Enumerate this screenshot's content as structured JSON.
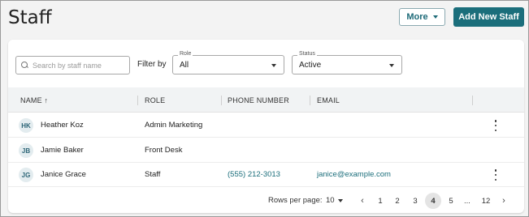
{
  "header": {
    "title": "Staff",
    "more_label": "More",
    "add_label": "Add New Staff"
  },
  "filters": {
    "search_placeholder": "Search by staff name",
    "filter_by_label": "Filter by",
    "role": {
      "legend": "Role",
      "value": "All"
    },
    "status": {
      "legend": "Status",
      "value": "Active"
    }
  },
  "table": {
    "columns": [
      "NAME ↑",
      "ROLE",
      "PHONE NUMBER",
      "EMAIL"
    ],
    "rows": [
      {
        "initials": "HK",
        "name": "Heather Koz",
        "role": "Admin Marketing",
        "phone": "",
        "email": ""
      },
      {
        "initials": "JB",
        "name": "Jamie Baker",
        "role": "Front Desk",
        "phone": "",
        "email": ""
      },
      {
        "initials": "JG",
        "name": "Janice Grace",
        "role": "Staff",
        "phone": "(555) 212-3013",
        "email": "janice@example.com"
      }
    ]
  },
  "pagination": {
    "rows_per_page_label": "Rows per page:",
    "rows_per_page_value": "10",
    "prev_icon": "chevron-left-icon",
    "next_icon": "chevron-right-icon",
    "pages": [
      "1",
      "2",
      "3",
      "4",
      "5",
      "...",
      "12"
    ],
    "current_page": "4"
  },
  "colors": {
    "accent": "#1b6e7b",
    "background": "#f3f3f3"
  }
}
